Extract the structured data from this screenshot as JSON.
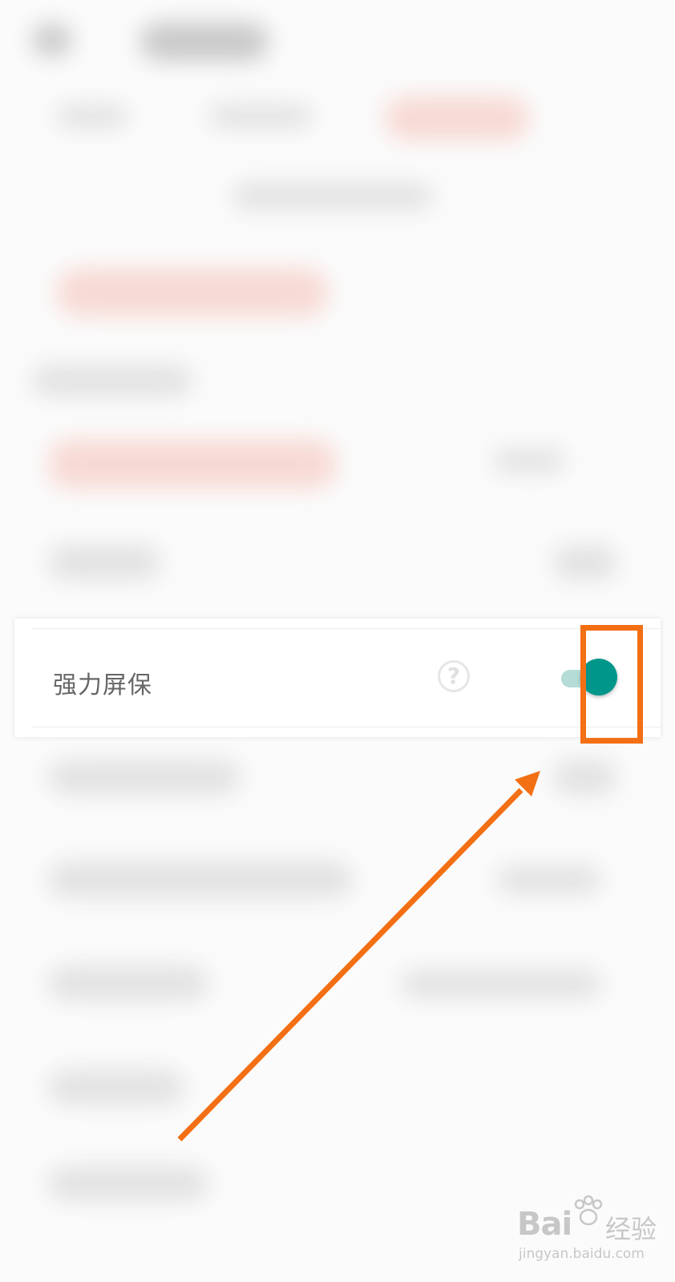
{
  "setting_row": {
    "label": "强力屏保",
    "help_icon": "question-circle-icon",
    "help_glyph": "?",
    "toggle_state": "on"
  },
  "colors": {
    "toggle_thumb": "#00968a",
    "toggle_track": "#b5dcd6",
    "annotation": "#f36f14",
    "label_text": "#666666"
  },
  "annotation": {
    "box_color": "#f36f14",
    "arrow_color": "#f36f14"
  },
  "watermark": {
    "logo_text": "Bai",
    "logo_cn": "经验",
    "url": "jingyan.baidu.com"
  }
}
